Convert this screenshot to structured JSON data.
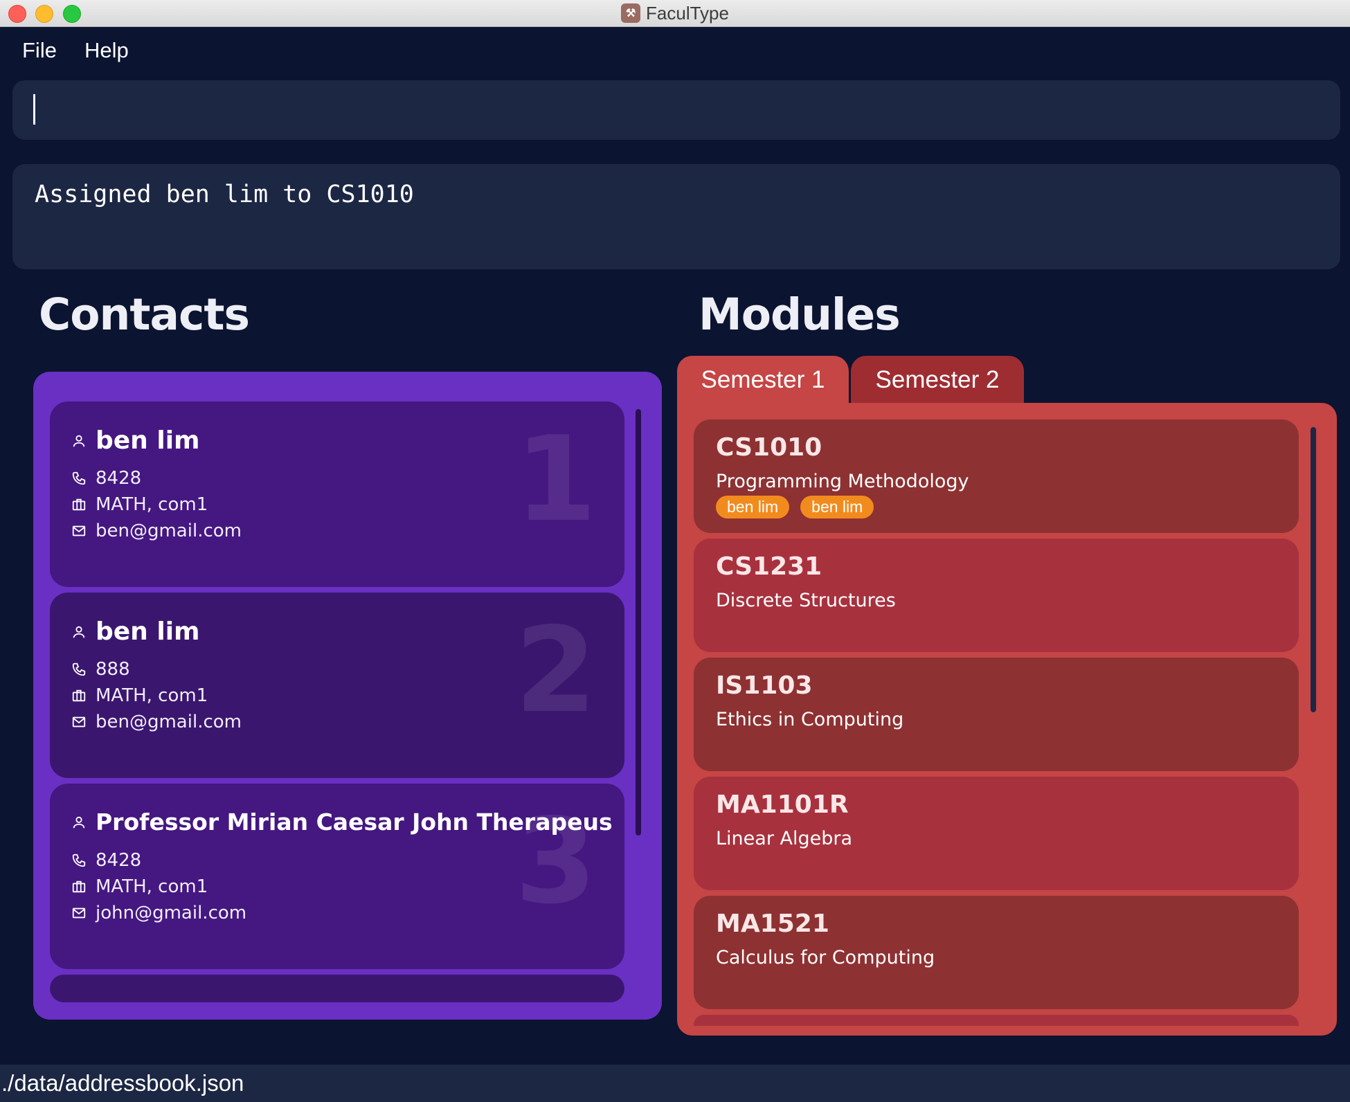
{
  "window": {
    "title": "FaculType"
  },
  "menu": {
    "file": "File",
    "help": "Help"
  },
  "command": {
    "value": ""
  },
  "result": {
    "message": "Assigned ben lim to CS1010"
  },
  "contacts": {
    "title": "Contacts",
    "items": [
      {
        "index": "1",
        "name": "ben lim",
        "phone": "8428",
        "tags": "MATH, com1",
        "email": "ben@gmail.com"
      },
      {
        "index": "2",
        "name": "ben lim",
        "phone": "888",
        "tags": "MATH, com1",
        "email": "ben@gmail.com"
      },
      {
        "index": "3",
        "name": "Professor Mirian Caesar John Therapeus",
        "phone": "8428",
        "tags": "MATH, com1",
        "email": "john@gmail.com"
      }
    ]
  },
  "modules": {
    "title": "Modules",
    "tabs": [
      {
        "label": "Semester 1",
        "selected": true
      },
      {
        "label": "Semester 2",
        "selected": false
      }
    ],
    "items": [
      {
        "code": "CS1010",
        "name": "Programming Methodology",
        "tags": [
          "ben lim",
          "ben lim"
        ]
      },
      {
        "code": "CS1231",
        "name": "Discrete Structures",
        "tags": []
      },
      {
        "code": "IS1103",
        "name": "Ethics in Computing",
        "tags": []
      },
      {
        "code": "MA1101R",
        "name": "Linear Algebra",
        "tags": []
      },
      {
        "code": "MA1521",
        "name": "Calculus for Computing",
        "tags": []
      }
    ]
  },
  "status": {
    "path": "./data/addressbook.json"
  },
  "colors": {
    "background": "#0b1430",
    "panel": "#1c2744",
    "contacts_panel": "#6930c3",
    "contact_card": "#451781",
    "modules_panel": "#c64545",
    "module_card": "#8e3132",
    "tag": "#f28b1e"
  },
  "icons": {
    "name": "person-icon",
    "phone": "phone-icon",
    "tags": "briefcase-icon",
    "email": "mail-icon"
  }
}
